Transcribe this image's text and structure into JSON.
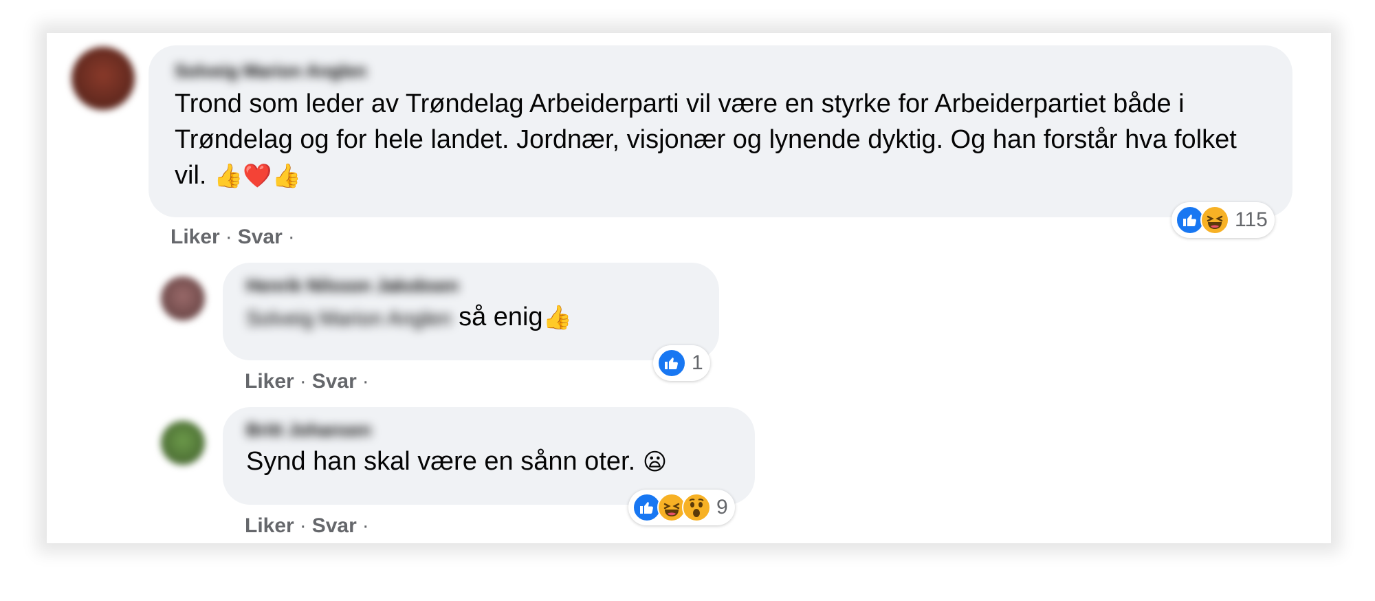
{
  "comments": [
    {
      "author": "Solveig Marion Anglen",
      "text": "Trond som leder av Trøndelag Arbeiderparti vil være en styrke for Arbeiderpartiet både i Trøndelag og for hele landet. Jordnær, visjonær og lynende dyktig. Og han forstår hva folket vil.",
      "emojis": [
        "👍",
        "❤️",
        "👍"
      ],
      "reactions": [
        "like-icon",
        "haha-icon"
      ],
      "reaction_count": "115",
      "actions": {
        "like": "Liker",
        "reply": "Svar",
        "separator": "·"
      }
    },
    {
      "author": "Henrik Nilsson Jakobsen",
      "mention": "Solveig Marion Anglen",
      "text": "så enig",
      "emojis": [
        "👍"
      ],
      "reactions": [
        "like-icon"
      ],
      "reaction_count": "1",
      "actions": {
        "like": "Liker",
        "reply": "Svar",
        "separator": "·"
      }
    },
    {
      "author": "Britt Johansen",
      "text": "Synd han skal være en sånn oter.",
      "emojis": [
        "😦"
      ],
      "reactions": [
        "like-icon",
        "haha-icon",
        "wow-icon"
      ],
      "reaction_count": "9",
      "actions": {
        "like": "Liker",
        "reply": "Svar",
        "separator": "·"
      }
    }
  ],
  "colors": {
    "bubble": "#f0f2f5",
    "text": "#050505",
    "meta": "#65676b",
    "like": "#1877f2",
    "emoji_yellow": "#f7b125"
  }
}
